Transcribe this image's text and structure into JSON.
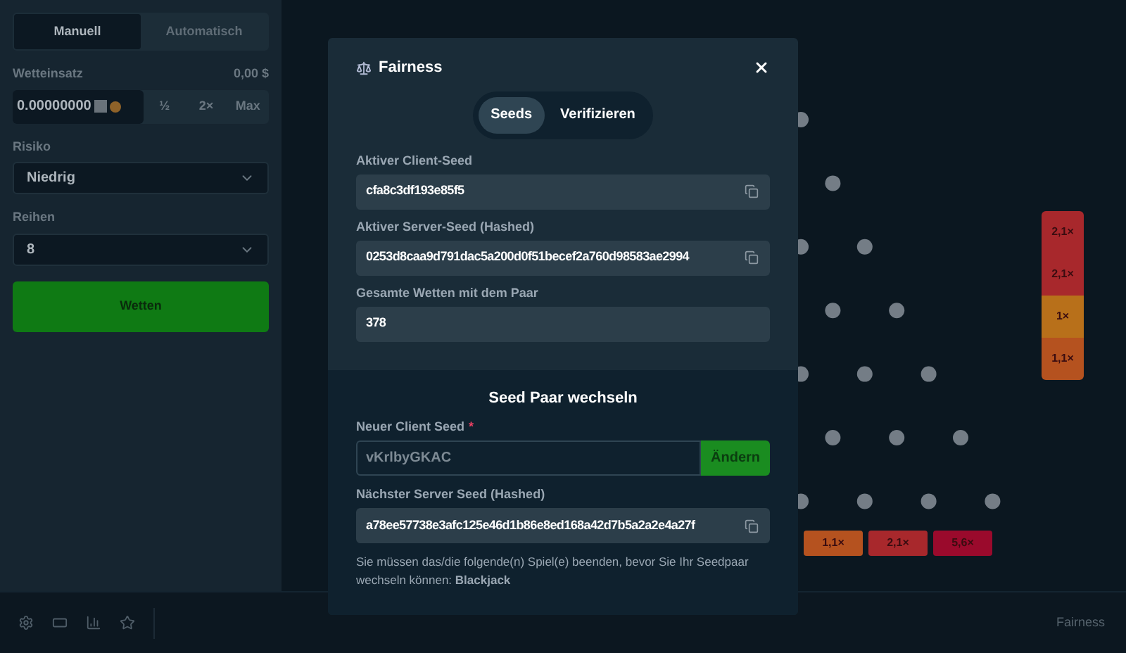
{
  "sidebar": {
    "tabs": [
      {
        "label": "Manuell",
        "selected": true
      },
      {
        "label": "Automatisch",
        "selected": false
      }
    ],
    "bet": {
      "label": "Wetteinsatz",
      "amount_usd": "0,00 $",
      "value": "0.00000000",
      "buttons": [
        "½",
        "2×",
        "Max"
      ]
    },
    "risk": {
      "label": "Risiko",
      "value": "Niedrig"
    },
    "rows": {
      "label": "Reihen",
      "value": "8"
    },
    "bet_button": "Wetten"
  },
  "board": {
    "buckets": [
      {
        "label": "1,1×",
        "color": "#b5521f"
      },
      {
        "label": "2,1×",
        "color": "#a8282c"
      },
      {
        "label": "5,6×",
        "color": "#9a0a2c"
      }
    ],
    "history": [
      {
        "label": "2,1×",
        "color": "#a8282c"
      },
      {
        "label": "2,1×",
        "color": "#a8282c"
      },
      {
        "label": "1×",
        "color": "#b8701a"
      },
      {
        "label": "1,1×",
        "color": "#b5521f"
      }
    ]
  },
  "footer": {
    "link": "Fairness"
  },
  "modal": {
    "title": "Fairness",
    "tabs": [
      {
        "label": "Seeds",
        "selected": true
      },
      {
        "label": "Verifizieren",
        "selected": false
      }
    ],
    "fields": [
      {
        "label": "Aktiver Client-Seed",
        "value": "cfa8c3df193e85f5",
        "copyable": true
      },
      {
        "label": "Aktiver Server-Seed (Hashed)",
        "value": "0253d8caa9d791dac5a200d0f51becef2a760d98583ae2994",
        "copyable": true
      },
      {
        "label": "Gesamte Wetten mit dem Paar",
        "value": "378",
        "copyable": false
      }
    ],
    "change": {
      "heading": "Seed Paar wechseln",
      "client_label": "Neuer Client Seed",
      "required_mark": "*",
      "client_value": "vKrlbyGKAC",
      "change_button": "Ändern",
      "server_label": "Nächster Server Seed (Hashed)",
      "server_value": "a78ee57738e3afc125e46d1b86e8ed168a42d7b5a2a2e4a27f",
      "note": "Sie müssen das/die folgende(n) Spiel(e) beenden, bevor Sie Ihr Seedpaar wechseln können: **Blackjack**"
    }
  }
}
